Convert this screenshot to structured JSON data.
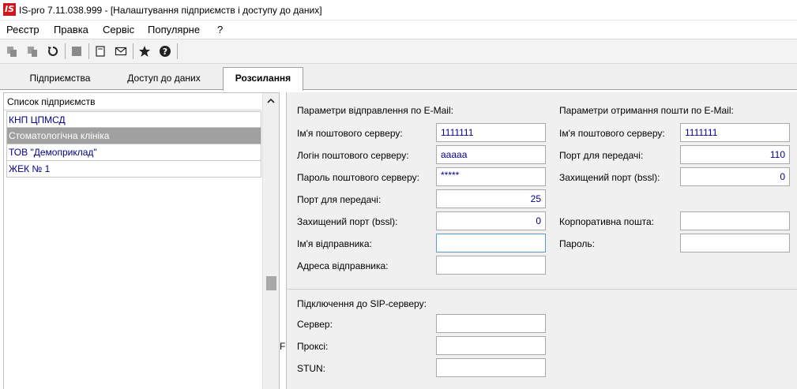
{
  "window": {
    "title": "IS-pro 7.11.038.999 - [Налаштування підприємств і доступу до даних]",
    "logo": "IS"
  },
  "menu": [
    "Реєстр",
    "Правка",
    "Сервіс",
    "Популярне",
    "?"
  ],
  "toolbar": {
    "icons": [
      "copy-icon",
      "paste-icon",
      "refresh-icon",
      "stop-icon",
      "document-icon",
      "mail-icon",
      "star-icon",
      "help-icon"
    ]
  },
  "tabs": [
    {
      "label": "Підприємства",
      "active": false
    },
    {
      "label": "Доступ до даних",
      "active": false
    },
    {
      "label": "Розсилання",
      "active": true
    }
  ],
  "enterprise_list": {
    "header": "Список підприємств",
    "items": [
      {
        "label": "КНП ЦПМСД",
        "selected": false
      },
      {
        "label": "Стоматологічна клініка",
        "selected": true
      },
      {
        "label": "ТОВ \"Демоприклад\"",
        "selected": false
      },
      {
        "label": "ЖЕК № 1",
        "selected": false
      }
    ]
  },
  "pane_marker": "F",
  "email_send": {
    "title": "Параметри відправлення по E-Mail:",
    "server_label": "Ім'я поштового серверу:",
    "server_value": "1111111",
    "login_label": "Логін поштового серверу:",
    "login_value": "aaaaa",
    "password_label": "Пароль поштового серверу:",
    "password_value": "*****",
    "port_label": "Порт для передачі:",
    "port_value": "25",
    "ssl_port_label": "Захищений порт (bssl):",
    "ssl_port_value": "0",
    "sender_name_label": "Ім'я відправника:",
    "sender_name_value": "",
    "sender_address_label": "Адреса відправника:",
    "sender_address_value": ""
  },
  "email_receive": {
    "title": "Параметри отримання пошти по E-Mail:",
    "server_label": "Ім'я поштового серверу:",
    "server_value": "1111111",
    "port_label": "Порт для передачі:",
    "port_value": "110",
    "ssl_port_label": "Захищений порт (bssl):",
    "ssl_port_value": "0",
    "corp_mail_label": "Корпоративна пошта:",
    "corp_mail_value": "",
    "password_label": "Пароль:",
    "password_value": ""
  },
  "sip": {
    "title": "Підключення до SIP-серверу:",
    "server_label": "Сервер:",
    "server_value": "",
    "proxy_label": "Проксі:",
    "proxy_value": "",
    "stun_label": "STUN:",
    "stun_value": ""
  },
  "colors": {
    "accent": "#d0161b",
    "value_text": "#00008b",
    "selection": "#a0a0a0"
  }
}
